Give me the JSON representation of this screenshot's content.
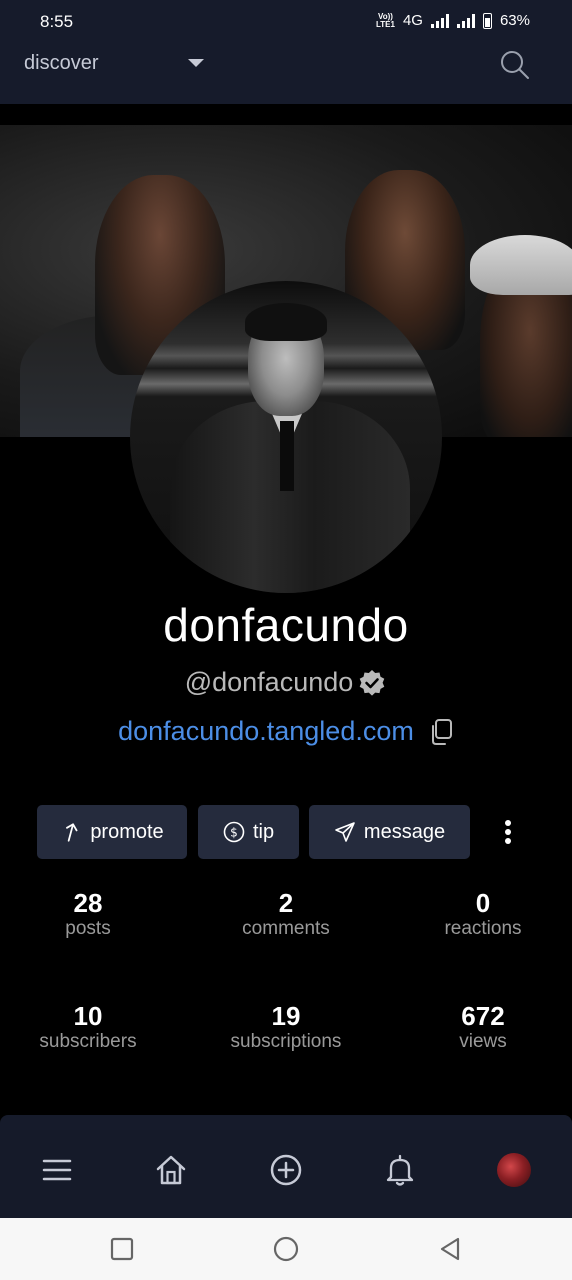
{
  "status_bar": {
    "time": "8:55",
    "volte_line1": "Vo))",
    "volte_line2": "LTE1",
    "network": "4G",
    "battery": "63%",
    "battery_level": 0.63
  },
  "app_bar": {
    "title": "discover",
    "icons": [
      "chevron-down-icon",
      "search-icon"
    ]
  },
  "profile": {
    "display_name": "donfacundo",
    "handle": "@donfacundo",
    "verified": true,
    "url": "donfacundo.tangled.com"
  },
  "actions": {
    "promote_label": "promote",
    "tip_label": "tip",
    "message_label": "message",
    "icons": [
      "arrow-up-icon",
      "dollar-coin-icon",
      "send-icon",
      "more-vertical-icon"
    ]
  },
  "stats": [
    {
      "value": "28",
      "label": "posts"
    },
    {
      "value": "2",
      "label": "comments"
    },
    {
      "value": "0",
      "label": "reactions"
    },
    {
      "value": "10",
      "label": "subscribers"
    },
    {
      "value": "19",
      "label": "subscriptions"
    },
    {
      "value": "672",
      "label": "views"
    }
  ],
  "bottom_nav": {
    "items": [
      "menu-icon",
      "home-icon",
      "add-icon",
      "bell-icon",
      "profile-avatar"
    ]
  },
  "system_nav": {
    "items": [
      "recents-icon",
      "home-circle-icon",
      "back-icon"
    ]
  },
  "colors": {
    "background": "#000000",
    "bar": "#161b2b",
    "button": "#252b3d",
    "link": "#4c8ee6"
  }
}
